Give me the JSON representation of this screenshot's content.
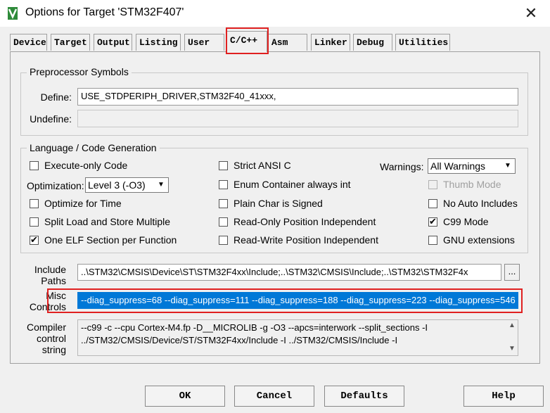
{
  "window": {
    "title": "Options for Target 'STM32F407'",
    "app_icon": "keil-uvision-icon",
    "close_glyph": "✕"
  },
  "tabs": [
    {
      "label": "Device"
    },
    {
      "label": "Target"
    },
    {
      "label": "Output"
    },
    {
      "label": "Listing"
    },
    {
      "label": "User"
    },
    {
      "label": "C/C++",
      "active": true
    },
    {
      "label": "Asm"
    },
    {
      "label": "Linker"
    },
    {
      "label": "Debug"
    },
    {
      "label": "Utilities"
    }
  ],
  "preprocessor": {
    "legend": "Preprocessor Symbols",
    "define_label": "Define:",
    "define_value": "USE_STDPERIPH_DRIVER,STM32F40_41xxx,",
    "undefine_label": "Undefine:",
    "undefine_value": ""
  },
  "language": {
    "legend": "Language / Code Generation",
    "execute_only": {
      "label": "Execute-only Code",
      "checked": false
    },
    "optimization_label": "Optimization:",
    "optimization_value": "Level 3 (-O3)",
    "optimize_time": {
      "label": "Optimize for Time",
      "checked": false
    },
    "split_load": {
      "label": "Split Load and Store Multiple",
      "checked": false
    },
    "one_elf": {
      "label": "One ELF Section per Function",
      "checked": true
    },
    "strict_ansi": {
      "label": "Strict ANSI C",
      "checked": false
    },
    "enum_container": {
      "label": "Enum Container always int",
      "checked": false
    },
    "plain_char": {
      "label": "Plain Char is Signed",
      "checked": false
    },
    "ro_pi": {
      "label": "Read-Only Position Independent",
      "checked": false
    },
    "rw_pi": {
      "label": "Read-Write Position Independent",
      "checked": false
    },
    "warnings_label": "Warnings:",
    "warnings_value": "All Warnings",
    "thumb_mode": {
      "label": "Thumb Mode",
      "checked": false,
      "disabled": true
    },
    "no_auto_includes": {
      "label": "No Auto Includes",
      "checked": false
    },
    "c99_mode": {
      "label": "C99 Mode",
      "checked": true
    },
    "gnu_extensions": {
      "label": "GNU extensions",
      "checked": false
    }
  },
  "include_paths": {
    "label_line1": "Include",
    "label_line2": "Paths",
    "value": "..\\STM32\\CMSIS\\Device\\ST\\STM32F4xx\\Include;..\\STM32\\CMSIS\\Include;..\\STM32\\STM32F4x",
    "browse_label": "..."
  },
  "misc_controls": {
    "label_line1": "Misc",
    "label_line2": "Controls",
    "value": "--diag_suppress=68 --diag_suppress=111 --diag_suppress=188 --diag_suppress=223 --diag_suppress=546",
    "highlight_color": "#e02020",
    "selection_color": "#0078d7"
  },
  "compiler_string": {
    "label_line1": "Compiler",
    "label_line2": "control",
    "label_line3": "string",
    "line1": "--c99 -c --cpu Cortex-M4.fp -D__MICROLIB -g -O3 --apcs=interwork --split_sections -I",
    "line2": "../STM32/CMSIS/Device/ST/STM32F4xx/Include -I ../STM32/CMSIS/Include -I"
  },
  "buttons": {
    "ok": "OK",
    "cancel": "Cancel",
    "defaults": "Defaults",
    "help": "Help"
  }
}
